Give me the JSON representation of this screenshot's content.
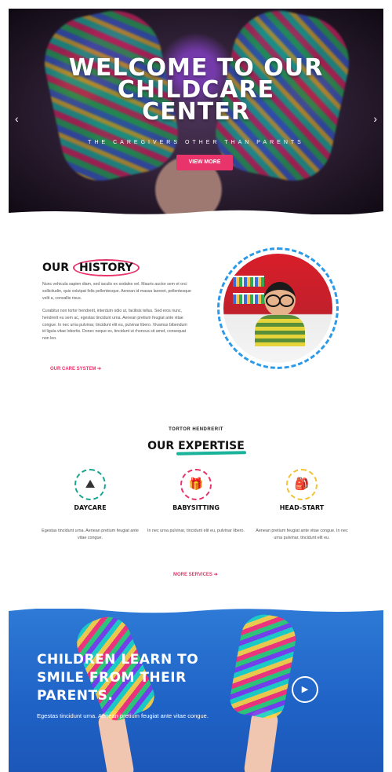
{
  "hero": {
    "title_line1": "Welcome to our",
    "title_line2": "childcare",
    "title_line3": "center",
    "subtitle": "The caregivers other than parents",
    "button": "VIEW MORE",
    "prev_icon": "chevron-left-icon",
    "next_icon": "chevron-right-icon"
  },
  "history": {
    "title_prefix": "Our",
    "title_highlight": "History",
    "paragraph1": "Nunc vehicula sapien diam, sed iaculis ex sodales vel. Mauris auctor sem et orci sollicitudin, quis volutpat felis pellentesque. Aenean id massa laoreet, pellentesque velit a, convallis risus.",
    "paragraph2": "Curabitur non tortor hendrerit, interdum odio ut, facilisis tellus. Sed eros nunc, hendrerit eu sem ac, egestas tincidunt urna. Aenean pretium feugiat ante vitae congue. In nec urna pulvinar, tincidunt elit eu, pulvinar libero. Vivamus bibendum id ligula vitae lobortis. Donec neque ex, tincidunt ut rhoncus sit amet, consequat non leo.",
    "link": "OUR CARE SYSTEM ➔"
  },
  "expertise": {
    "eyebrow": "TORTOR HENDRERIT",
    "title_prefix": "Our",
    "title_highlight": "Expertise",
    "services": [
      {
        "name": "Daycare",
        "icon": "landscape-icon",
        "glyph": "⛰",
        "color": "#18a58f",
        "desc": "Egestas tincidunt urna. Aenean pretium feugiat ante vitae congue."
      },
      {
        "name": "Babysitting",
        "icon": "gift-icon",
        "glyph": "🎁",
        "color": "#e8336b",
        "desc": "In nec urna pulvinar, tincidunt elit eu, pulvinar libero."
      },
      {
        "name": "Head-start",
        "icon": "backpack-icon",
        "glyph": "🎒",
        "color": "#f1c232",
        "desc": "Aenean pretium feugiat ante vitae congue. In nec urna pulvinar, tincidunt elit eu."
      }
    ],
    "link": "MORE SERVICES ➔"
  },
  "banner": {
    "title_line1": "Children learn to",
    "title_line2": "smile from their",
    "title_line3": "parents.",
    "subtitle": "Egestas tincidunt urna. Aenean pretium feugiat ante vitae congue.",
    "play_icon": "play-icon"
  },
  "colors": {
    "accent_pink": "#e8336b",
    "accent_teal": "#18b39a",
    "accent_blue": "#2b9ae8",
    "banner_blue": "#1f62c6"
  }
}
